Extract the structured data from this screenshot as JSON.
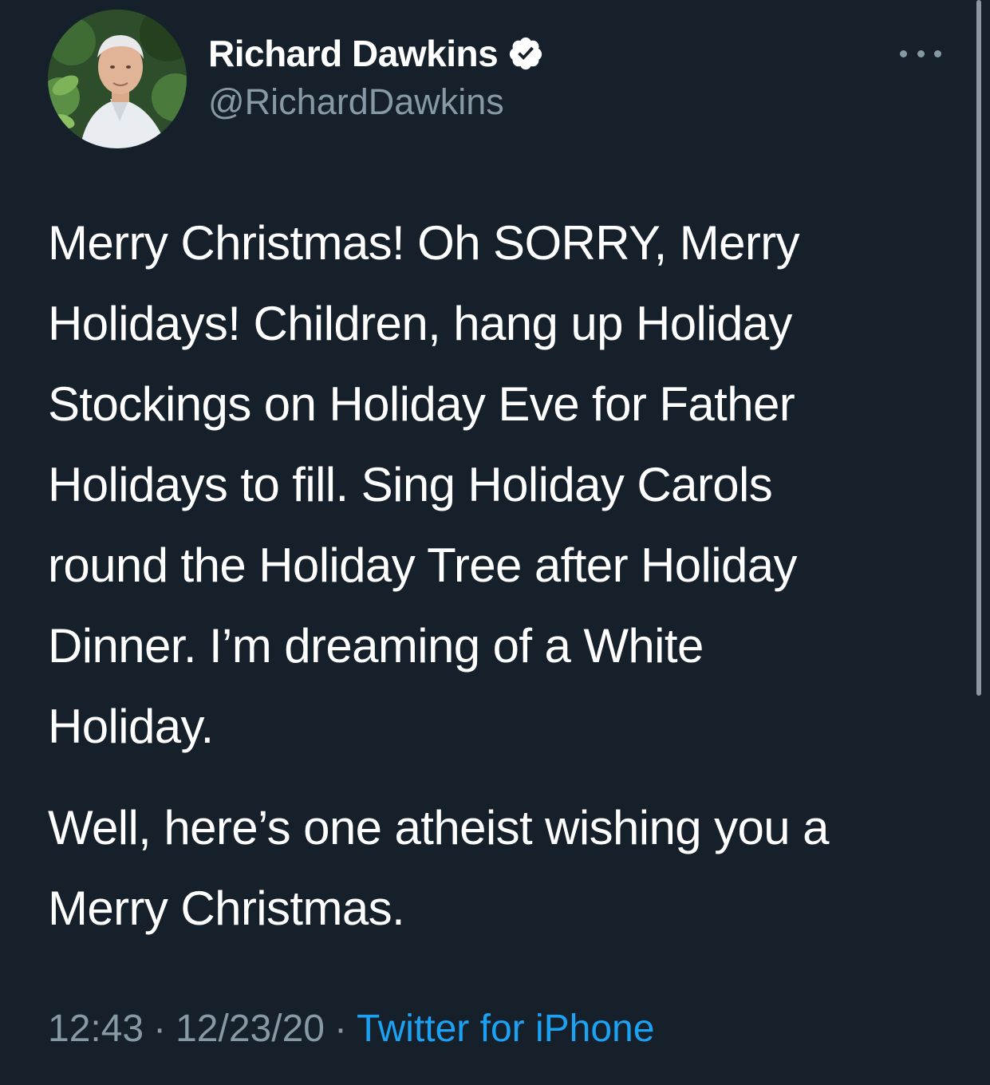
{
  "author": {
    "name": "Richard Dawkins",
    "handle": "@RichardDawkins",
    "avatar_icon": "profile-photo",
    "verified_icon": "verified-badge-icon"
  },
  "menu": {
    "icon": "more-options-icon"
  },
  "tweet": {
    "paragraph_1": "Merry Christmas! Oh SORRY, Merry\nHolidays! Children, hang up Holiday\nStockings on Holiday Eve for Father\nHolidays to fill. Sing Holiday Carols\nround the Holiday Tree after Holiday\nDinner. I’m dreaming of a White\nHoliday.",
    "paragraph_2": "Well, here’s one atheist wishing you a\nMerry Christmas."
  },
  "meta": {
    "time": "12:43",
    "separator": "·",
    "date": "12/23/20",
    "source": "Twitter for iPhone"
  },
  "colors": {
    "background": "#15202b",
    "text": "#ffffff",
    "secondary": "#8899a6",
    "link": "#1da1f2"
  }
}
